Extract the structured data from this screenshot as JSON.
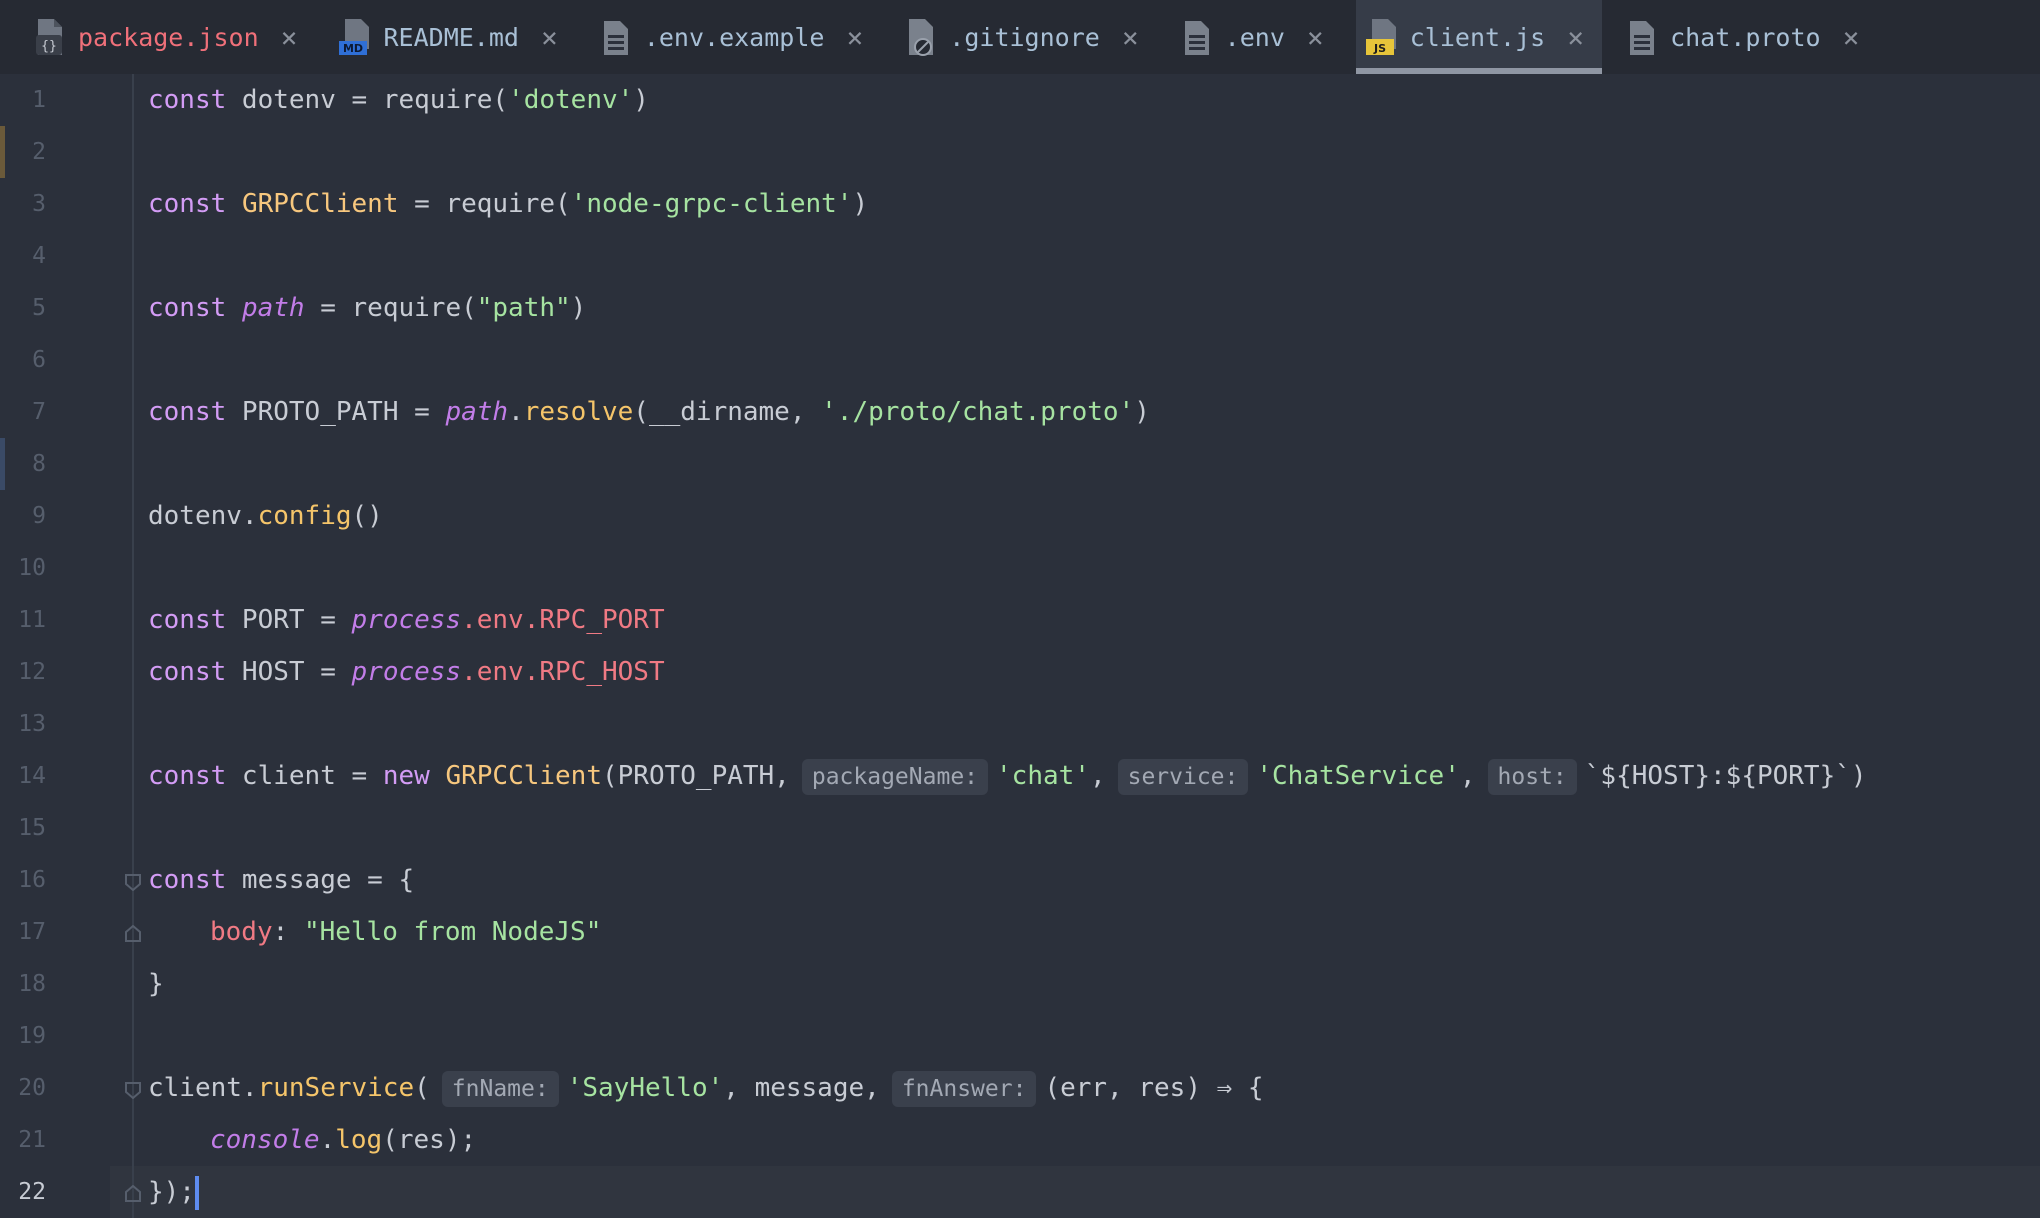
{
  "tabs": [
    {
      "name": "package.json",
      "icon": "package-json-icon",
      "modified": true,
      "active": false,
      "close": "×"
    },
    {
      "name": "README.md",
      "icon": "markdown-file-icon",
      "modified": false,
      "active": false,
      "close": "×",
      "badge": "MD"
    },
    {
      "name": ".env.example",
      "icon": "text-file-icon",
      "modified": false,
      "active": false,
      "close": "×"
    },
    {
      "name": ".gitignore",
      "icon": "gitignore-file-icon",
      "modified": false,
      "active": false,
      "close": "×"
    },
    {
      "name": ".env",
      "icon": "text-file-icon",
      "modified": false,
      "active": false,
      "close": "×"
    },
    {
      "name": "client.js",
      "icon": "javascript-file-icon",
      "modified": false,
      "active": true,
      "close": "×",
      "badge": "JS"
    },
    {
      "name": "chat.proto",
      "icon": "text-file-icon",
      "modified": false,
      "active": false,
      "close": "×"
    }
  ],
  "editor": {
    "current_line": 22,
    "line_numbers": [
      "1",
      "2",
      "3",
      "4",
      "5",
      "6",
      "7",
      "8",
      "9",
      "10",
      "11",
      "12",
      "13",
      "14",
      "15",
      "16",
      "17",
      "18",
      "19",
      "20",
      "21",
      "22"
    ],
    "code": {
      "l1": {
        "kw": "const",
        "a": " dotenv = require(",
        "s": "'dotenv'",
        "b": ")"
      },
      "l3": {
        "kw": "const",
        "cls": "GRPCClient",
        "a": " = require(",
        "s": "'node-grpc-client'",
        "b": ")"
      },
      "l5": {
        "kw": "const",
        "it": "path",
        "a": " = require(",
        "s": "\"path\"",
        "b": ")"
      },
      "l7": {
        "kw": "const",
        "a": " PROTO_PATH = ",
        "it": "path",
        "dot": ".",
        "fn": "resolve",
        "b": "(__dirname, ",
        "s": "'./proto/chat.proto'",
        "c": ")"
      },
      "l9": {
        "a": "dotenv.",
        "fn": "config",
        "b": "()"
      },
      "l11": {
        "kw": "const",
        "a": " PORT = ",
        "it": "process",
        "p1": ".env.",
        "p2": "RPC_PORT"
      },
      "l12": {
        "kw": "const",
        "a": " HOST = ",
        "it": "process",
        "p1": ".env.",
        "p2": "RPC_HOST"
      },
      "l14": {
        "kw": "const",
        "a": " client = ",
        "kw2": "new",
        "cls": "GRPCClient",
        "b": "(PROTO_PATH,",
        "h1": "packageName:",
        "s1": "'chat'",
        "c1": ",",
        "h2": "service:",
        "s2": "'ChatService'",
        "c2": ",",
        "h3": "host:",
        "s3": "`${HOST}:${PORT}`",
        "e": ")"
      },
      "l16": {
        "kw": "const",
        "a": " message = {"
      },
      "l17": {
        "prop": "body",
        "a": ": ",
        "s": "\"Hello from NodeJS\""
      },
      "l18": {
        "a": "}"
      },
      "l20": {
        "a": "client.",
        "fn": "runService",
        "b": "(",
        "h1": "fnName:",
        "s1": "'SayHello'",
        "c1": ", message,",
        "h2": "fnAnswer:",
        "e": "(err, res) ⇒ {"
      },
      "l21": {
        "it": "console",
        "dot": ".",
        "fn": "log",
        "b": "(res);"
      },
      "l22": {
        "a": "});"
      }
    }
  },
  "colors": {
    "background": "#2b303b",
    "keyword": "#d39cf5",
    "string": "#a6e3a1",
    "function": "#f5c56a",
    "property": "#f07a84",
    "caret": "#5e8cf0"
  }
}
